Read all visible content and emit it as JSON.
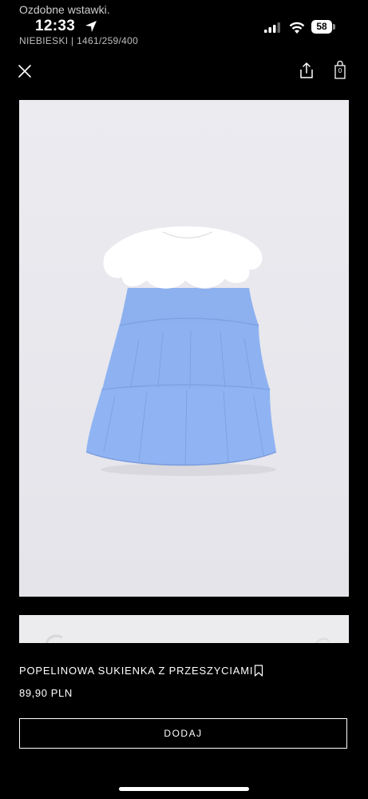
{
  "status_bar": {
    "preview_text": "Ozdobne wstawki.",
    "time": "12:33",
    "battery": "58",
    "meta": "NIEBIESKI | 1461/259/400"
  },
  "toolbar": {
    "bag_count": "0"
  },
  "product": {
    "name": "POPELINOWA SUKIENKA Z PRZESZYCIAMI",
    "price": "89,90 PLN",
    "add_label": "DODAJ"
  },
  "icons": [
    "close-icon",
    "share-icon",
    "shopping-bag-icon",
    "bookmark-icon",
    "location-arrow-icon",
    "signal-icon",
    "wifi-icon"
  ],
  "colors": {
    "background": "#000000",
    "dress_blue": "#8fb2f0",
    "collar_white": "#ffffff",
    "photo_bg": "#e9e9ee"
  }
}
